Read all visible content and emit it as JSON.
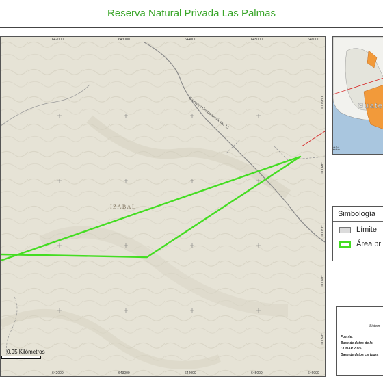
{
  "title": "Reserva Natural Privada Las Palmas",
  "map": {
    "region_label": "IZABAL",
    "road_label": "Carretera Centroamericana 13",
    "x_ticks": [
      "642000",
      "643000",
      "644000",
      "645000",
      "646000"
    ],
    "y_ticks": [
      "1749000",
      "1748000",
      "1747000",
      "1746000",
      "1745000"
    ],
    "colors": {
      "background": "#e6e3d6",
      "polygon": "#44dd22",
      "road": "#8a8a8a",
      "inset_pointer": "#d62020"
    }
  },
  "scale": {
    "label": "0.95 Kilómetros"
  },
  "inset": {
    "label": "Guate",
    "road_number": "221",
    "colors": {
      "sea": "#a9c6df",
      "land": "#f2f2ee",
      "highlight": "#f29a3a"
    }
  },
  "legend": {
    "title": "Simbología",
    "items": [
      {
        "label": "Límite",
        "style": "gray"
      },
      {
        "label": "Área pr",
        "style": "green"
      }
    ]
  },
  "info": {
    "system_title": "Sistem",
    "source_lines": [
      "Fuente:",
      "Base de datos de la",
      "CONAP 2026",
      "Base de datos cartogra"
    ]
  }
}
